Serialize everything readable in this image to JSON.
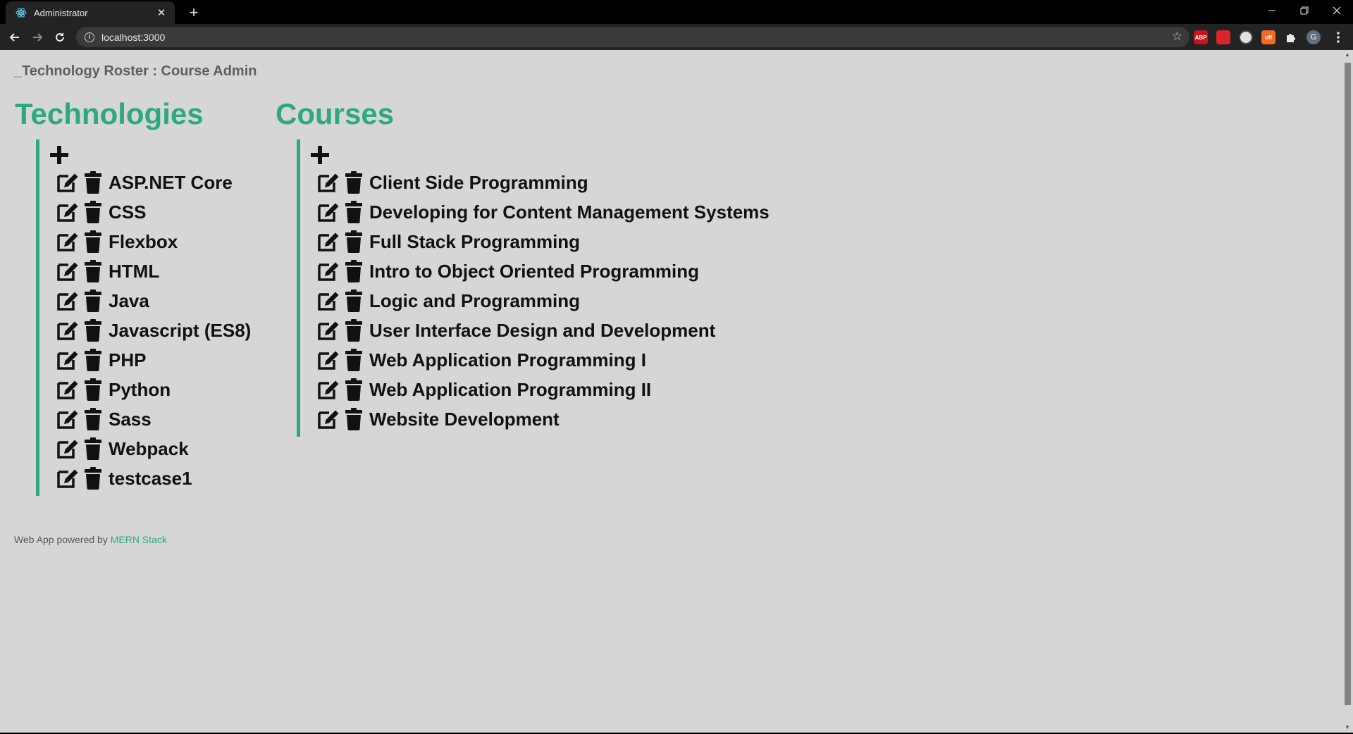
{
  "browser": {
    "tab_title": "Administrator",
    "url": "localhost:3000",
    "extensions": [
      {
        "name": "adblock-plus-icon",
        "text": "ABP",
        "color": "#c4161c"
      },
      {
        "name": "extension-red-icon",
        "text": "",
        "color": "#d8262c"
      },
      {
        "name": "extension-circle-icon",
        "text": "",
        "color": "#e0e0e0"
      },
      {
        "name": "extension-off-icon",
        "text": "off",
        "color": "#f26b21"
      },
      {
        "name": "extensions-puzzle-icon",
        "text": "",
        "color": ""
      },
      {
        "name": "profile-avatar-icon",
        "text": "G",
        "color": "#5f6f7f"
      }
    ]
  },
  "page": {
    "site_title": "_Technology Roster : Course Admin",
    "accent_color": "#2ea97d",
    "technologies": {
      "heading": "Technologies",
      "items": [
        "ASP.NET Core",
        "CSS",
        "Flexbox",
        "HTML",
        "Java",
        "Javascript (ES8)",
        "PHP",
        "Python",
        "Sass",
        "Webpack",
        "testcase1"
      ]
    },
    "courses": {
      "heading": "Courses",
      "items": [
        "Client Side Programming",
        "Developing for Content Management Systems",
        "Full Stack Programming",
        "Intro to Object Oriented Programming",
        "Logic and Programming",
        "User Interface Design and Development",
        "Web Application Programming I",
        "Web Application Programming II",
        "Website Development"
      ]
    },
    "footer": {
      "text": "Web App powered by",
      "link_text": "MERN Stack"
    }
  }
}
